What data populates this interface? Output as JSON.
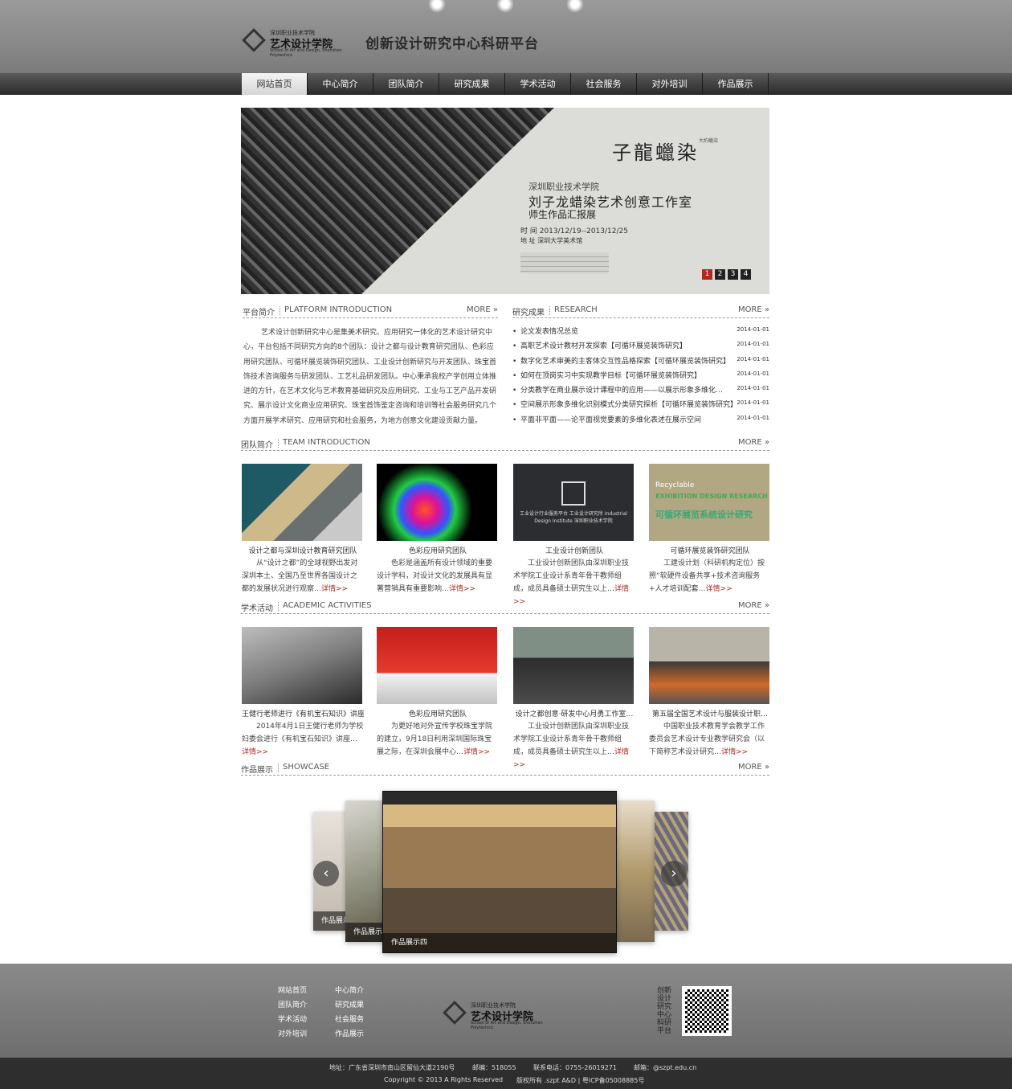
{
  "header": {
    "logo": {
      "line1": "深圳职业技术学院",
      "line2": "艺术设计学院",
      "line3": "School of Art and Design, Shenzhen Polytechnic"
    },
    "title": "创新设计研究中心科研平台"
  },
  "nav": {
    "items": [
      {
        "label": "网站首页",
        "active": true
      },
      {
        "label": "中心简介"
      },
      {
        "label": "团队简介"
      },
      {
        "label": "研究成果"
      },
      {
        "label": "学术活动"
      },
      {
        "label": "社会服务"
      },
      {
        "label": "对外培训"
      },
      {
        "label": "作品展示"
      }
    ]
  },
  "banner": {
    "calligraphy": "子龍蠟染",
    "tag": "大約蠟染",
    "school": "深圳职业技术学院",
    "title": "刘子龙蜡染艺术创意工作室",
    "subtitle": "师生作品汇报展",
    "time": "时 间 2013/12/19--2013/12/25",
    "place": "地 址 深圳大学美术馆",
    "pages": [
      "1",
      "2",
      "3",
      "4"
    ]
  },
  "platform": {
    "zh": "平台简介",
    "en": "PLATFORM INTRODUCTION",
    "more": "MORE",
    "text": "艺术设计创新研究中心是集美术研究、应用研究一体化的艺术设计研究中心，平台包括不同研究方向的8个团队：设计之都与设计教育研究团队、色彩应用研究团队、可循环展览装饰研究团队、工业设计创新研究与开发团队、珠宝首饰技术咨询服务与研发团队、工艺礼品研发团队。中心秉承我校产学创用立体推进的方针，在艺术文化与艺术教育基础研究及应用研究、工业与工艺产品开发研究、展示设计文化商业应用研究、珠宝首饰鉴定咨询和培训等社会服务研究几个方面开展学术研究、应用研究和社会服务，为地方创意文化建设贡献力量。"
  },
  "research": {
    "zh": "研究成果",
    "en": "RESEARCH",
    "more": "MORE",
    "items": [
      {
        "text": "论文发表情况总览",
        "date": "2014-01-01"
      },
      {
        "text": "高职艺术设计教材开发探索【可循环展览装饰研究】",
        "date": "2014-01-01"
      },
      {
        "text": "数字化艺术审美的主客体交互性品格探索【可循环展览装饰研究】",
        "date": "2014-01-01"
      },
      {
        "text": "如何在顶岗实习中实现教学目标【可循环展览装饰研究】",
        "date": "2014-01-01"
      },
      {
        "text": "分类教学在商业展示设计课程中的应用——以展示形象多维化…",
        "date": "2014-01-01"
      },
      {
        "text": "空间展示形象多维化识别模式分类研究探析【可循环展览装饰研究】",
        "date": "2014-01-01"
      },
      {
        "text": "平面非平面——论平面视觉要素的多维化表述在展示空间",
        "date": "2014-01-01"
      }
    ]
  },
  "team": {
    "zh": "团队简介",
    "en": "TEAM INTRODUCTION",
    "more": "MORE",
    "cards": [
      {
        "title": "设计之都与深圳设计教育研究团队",
        "desc": "从“设计之都”的全球视野出发对深圳本土、全国乃至世界各国设计之都的发展状况进行观察…",
        "detail": "详情>>"
      },
      {
        "title": "色彩应用研究团队",
        "desc": "色彩是涵盖所有设计领域的重要设计学科，对设计文化的发展具有显著营销具有重要影响…",
        "detail": "详情>>"
      },
      {
        "title": "工业设计创新团队",
        "desc": "工业设计创新团队由深圳职业技术学院工业设计系青年骨干教师组成，成员具备硕士研究生以上…",
        "detail": "详情>>",
        "logo": "工业设计行业服务平台 工业设计研究所 Industrial Design Institute 深圳职业技术学院"
      },
      {
        "title": "可循环展览装饰研究团队",
        "desc": "工建设计划（科研机构定位）按照“软硬件设备共享+技术咨询服务+人才培训配套…",
        "detail": "详情>>",
        "line1": "Recyclable",
        "line2": "EXHIBITION DESIGN RESEARCH",
        "line3": "可循环展览系统设计研究"
      }
    ]
  },
  "academic": {
    "zh": "学术活动",
    "en": "ACADEMIC ACTIVITIES",
    "more": "MORE",
    "cards": [
      {
        "title": "王健行老师进行《有机宝石知识》讲座",
        "desc": "2014年4月1日王健行老师为学校妇委会进行《有机宝石知识》讲座…",
        "detail": "详情>>"
      },
      {
        "title": "色彩应用研究团队",
        "desc": "为更好地对外宣传学校珠宝学院的建立，9月18日利用深圳国际珠宝展之际，在深圳会展中心…",
        "detail": "详情>>"
      },
      {
        "title": "设计之都创意·研发中心月勇工作室…",
        "desc": "工业设计创新团队由深圳职业技术学院工业设计系青年骨干教师组成，成员具备硕士研究生以上…",
        "detail": "详情>>"
      },
      {
        "title": "第五届全国艺术设计与服装设计职…",
        "desc": "中国职业技术教育学会教学工作委员会艺术设计专业教学研究会（以下简称艺术设计研究…",
        "detail": "详情>>"
      }
    ]
  },
  "showcase": {
    "zh": "作品展示",
    "en": "SHOWCASE",
    "more": "MORE",
    "items": [
      {
        "caption": "作品展示"
      },
      {
        "caption": "作品展示三"
      },
      {
        "caption": "作品展示四"
      }
    ]
  },
  "footer": {
    "links": [
      "网站首页",
      "中心简介",
      "团队简介",
      "研究成果",
      "学术活动",
      "社会服务",
      "对外培训",
      "作品展示"
    ],
    "qr_label": "创新设计研究中心科研平台",
    "address": "地址：广东省深圳市南山区留仙大道2190号",
    "postcode": "邮编：518055",
    "phone": "联系电话：0755-26019271",
    "email": "邮箱：@szpt.edu.cn",
    "copyright": "Copyright © 2013 A Rights Reserved",
    "icp": "版权所有 .szpt A&D | 粤ICP备05008885号"
  }
}
